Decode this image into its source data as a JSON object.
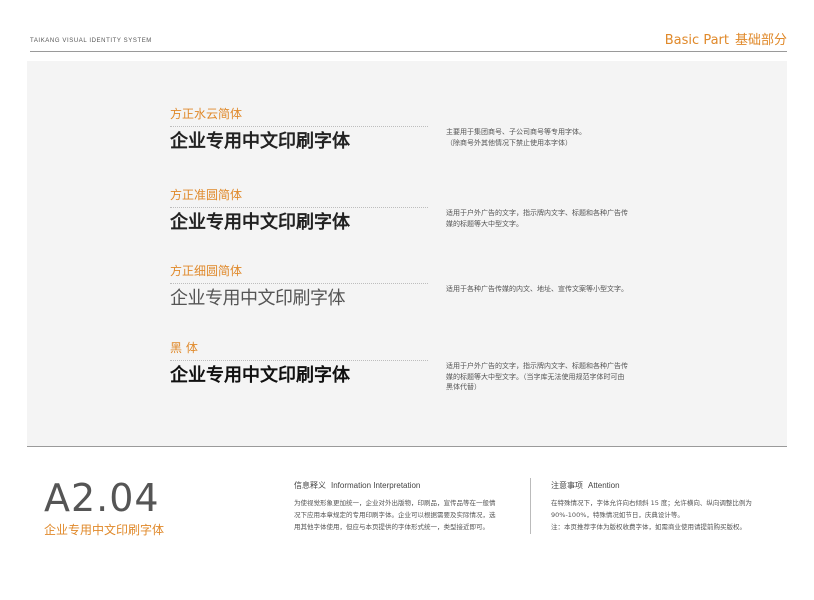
{
  "header": {
    "brand": "TAIKANG  VISUAL IDENTITY SYSTEM",
    "section_en": "Basic Part",
    "section_cn": "基础部分"
  },
  "fonts": [
    {
      "name": "方正水云简体",
      "sample": "企业专用中文印刷字体",
      "desc": [
        "主要用于集团商号、子公司商号等专用字体。",
        "（除商号外其他情况下禁止使用本字体）"
      ]
    },
    {
      "name": "方正准圆简体",
      "sample": "企业专用中文印刷字体",
      "desc": [
        "适用于户外广告的文字，指示牌内文字、标题和各种广告传",
        "媒的标题等大中型文字。"
      ]
    },
    {
      "name": "方正细圆简体",
      "sample": "企业专用中文印刷字体",
      "desc": [
        "适用于各种广告传媒的内文、地址、宣传文案等小型文字。"
      ]
    },
    {
      "name": "黑 体",
      "sample": "企业专用中文印刷字体",
      "desc": [
        "适用于户外广告的文字，指示牌内文字、标题和各种广告传",
        "媒的标题等大中型文字。（当字库无法使用规范字体时可由",
        "黑体代替）"
      ]
    }
  ],
  "footer": {
    "code": "A2.04",
    "title": "企业专用中文印刷字体",
    "info": {
      "heading_cn": "信息释义",
      "heading_en": "Information Interpretation",
      "lines": [
        "为使视觉形象更加统一，企业对外出版物，印刷品，宣传品等在一般情",
        "况下应用本章规定的专用印刷字体。企业可以根据需要及实际情况，选",
        "用其他字体使用，但应与本页提供的字体形式统一，类型接近即可。"
      ]
    },
    "attention": {
      "heading_cn": "注意事项",
      "heading_en": "Attention",
      "lines": [
        "在特殊情况下，字体允许向右倾斜 15 度；允许横向、纵向调整比例为",
        "90%-100%，特殊情况如节日，庆典设计等。",
        "注：本页推荐字体为版权收费字体，如需商业使用请提前购买版权。"
      ]
    }
  }
}
